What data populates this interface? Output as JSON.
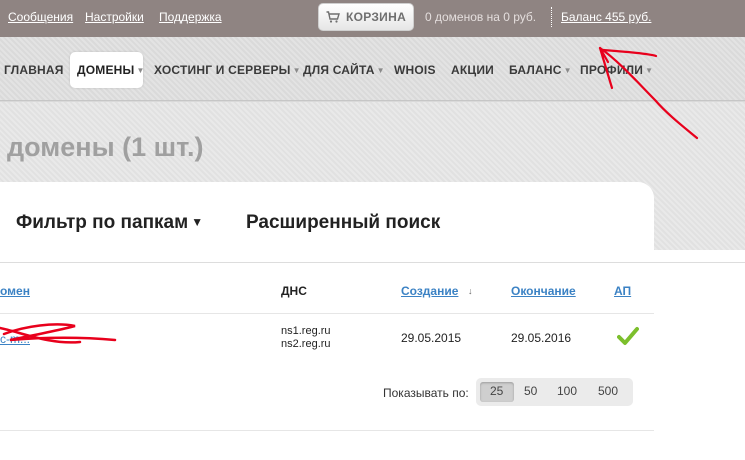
{
  "topbar": {
    "links": [
      "Сообщения",
      "Настройки",
      "Поддержка"
    ],
    "cart_label": "КОРЗИНА",
    "cart_info": "0 доменов на 0 руб.",
    "balance": "Баланс 455 руб."
  },
  "nav": {
    "items": [
      "ГЛАВНАЯ",
      "ДОМЕНЫ",
      "ХОСТИНГ И СЕРВЕРЫ",
      "ДЛЯ САЙТА",
      "WHOIS",
      "АКЦИИ",
      "БАЛАНС",
      "ПРОФИЛИ"
    ],
    "active": "ДОМЕНЫ"
  },
  "page": {
    "title": "домены (1 шт.)",
    "filter_label": "Фильтр по папкам",
    "advanced_search": "Расширенный поиск"
  },
  "table": {
    "headers": {
      "domain": "омен",
      "dns": "ДНС",
      "created": "Создание",
      "expires": "Окончание",
      "autorenew": "АП"
    },
    "rows": [
      {
        "domain": "cc-m...",
        "dns": [
          "ns1.reg.ru",
          "ns2.reg.ru"
        ],
        "created": "29.05.2015",
        "expires": "29.05.2016",
        "autorenew": true
      }
    ]
  },
  "pager": {
    "label": "Показывать по:",
    "options": [
      "25",
      "50",
      "100",
      "500"
    ],
    "selected": "25"
  },
  "colors": {
    "topbar": "#8f8482",
    "link": "#3b82c4",
    "check": "#7cbf2c",
    "annotation": "#e8001c"
  }
}
